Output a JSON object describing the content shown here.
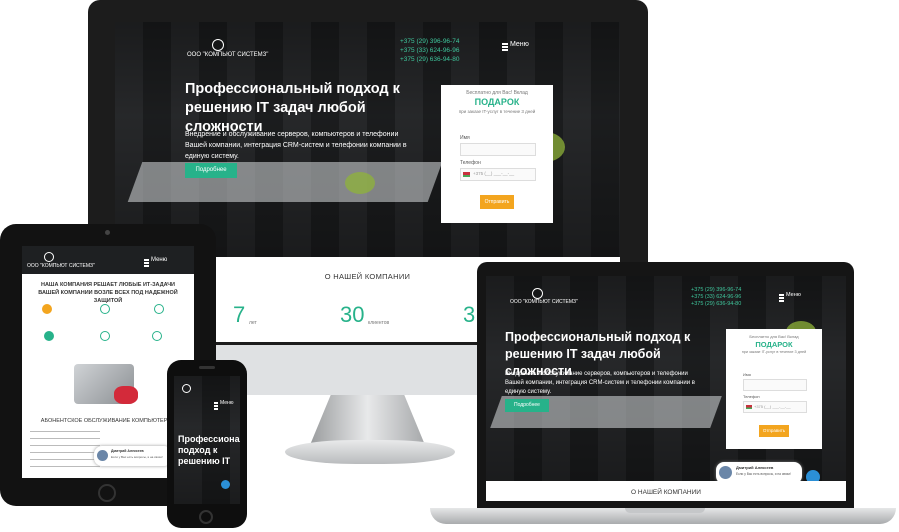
{
  "site": {
    "logo_text": "ООО \"КОМПЬЮТ СИСТЕМЗ\"",
    "menu_label": "Меню",
    "phones": [
      "+375 (29) 396-96-74",
      "+375 (33) 624-96-96",
      "+375 (29) 636-94-80"
    ],
    "hero_title": "Профессиональный подход к решению IT задач любой сложности",
    "hero_text": "Внедрение и обслуживание серверов, компьютеров и телефонии Вашей компании, интеграция CRM-систем и телефонии компании в единую систему.",
    "hero_button": "Подробнее",
    "form": {
      "intro": "Бесплатно для Вас! Вклад",
      "gift_title": "ПОДАРОК",
      "gift_text": "при заказе IT-услуг в течение 3 дней",
      "name_label": "Имя",
      "phone_label": "Телефон",
      "phone_value": "+375 (__) ___-__-__",
      "submit_label": "Отправить"
    },
    "about_title": "О НАШЕЙ КОМПАНИИ",
    "stats": [
      {
        "value": "7",
        "unit": "лет"
      },
      {
        "value": "30",
        "unit": "клиентов"
      },
      {
        "value": "3",
        "unit": ""
      }
    ],
    "tablet": {
      "headline": "НАША КОМПАНИЯ РЕШАЕТ ЛЮБЫЕ ИТ-ЗАДАЧИ ВАШЕЙ КОМПАНИИ ВОЗЛЕ ВСЕХ ПОД НАДЕЖНОЙ ЗАЩИТОЙ",
      "section_title": "АБОНЕНТСКОЕ ОБСЛУЖИВАНИЕ КОМПЬЮТЕРОВ"
    },
    "chat": {
      "name": "Дмитрий Алексеев",
      "text": "Если у Вас есть вопросы, я на связи!"
    },
    "phone_device": {
      "title": "Профессиональный подход к решению IT"
    }
  },
  "colors": {
    "accent_green": "#27b28a",
    "phone_green": "#3fc79d",
    "accent_orange": "#f3a51f",
    "gift_title": "#27b28a",
    "device_frame": "#111111"
  },
  "icons": [
    "logo-emblem-icon",
    "menu-burger-icon",
    "chat-icon",
    "person-avatar-icon",
    "flag-icon"
  ]
}
